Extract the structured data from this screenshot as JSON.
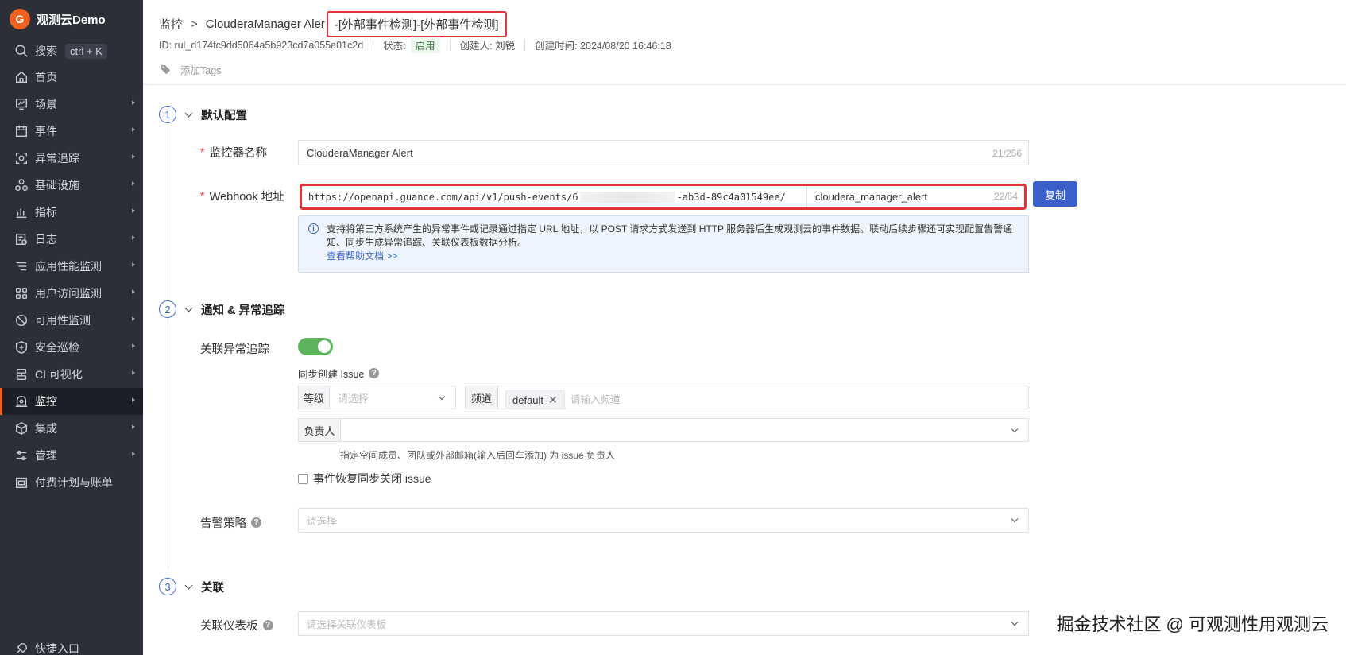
{
  "brand": {
    "logo_letter": "G",
    "name": "观测云Demo"
  },
  "sidebar": {
    "search_label": "搜索",
    "search_shortcut": "ctrl + K",
    "items": [
      {
        "label": "首页",
        "icon": "home-icon",
        "has_children": false
      },
      {
        "label": "场景",
        "icon": "scene-icon",
        "has_children": true
      },
      {
        "label": "事件",
        "icon": "event-icon",
        "has_children": true
      },
      {
        "label": "异常追踪",
        "icon": "anomaly-icon",
        "has_children": true
      },
      {
        "label": "基础设施",
        "icon": "infra-icon",
        "has_children": true
      },
      {
        "label": "指标",
        "icon": "metrics-icon",
        "has_children": true
      },
      {
        "label": "日志",
        "icon": "log-icon",
        "has_children": true
      },
      {
        "label": "应用性能监测",
        "icon": "apm-icon",
        "has_children": true
      },
      {
        "label": "用户访问监测",
        "icon": "rum-icon",
        "has_children": true
      },
      {
        "label": "可用性监测",
        "icon": "availability-icon",
        "has_children": true
      },
      {
        "label": "安全巡检",
        "icon": "security-icon",
        "has_children": true
      },
      {
        "label": "CI 可视化",
        "icon": "ci-icon",
        "has_children": true
      },
      {
        "label": "监控",
        "icon": "monitor-icon",
        "has_children": true,
        "active": true
      },
      {
        "label": "集成",
        "icon": "integration-icon",
        "has_children": true
      },
      {
        "label": "管理",
        "icon": "manage-icon",
        "has_children": true
      },
      {
        "label": "付费计划与账单",
        "icon": "billing-icon",
        "has_children": false
      }
    ],
    "quick_entry": "快捷入口"
  },
  "header": {
    "breadcrumb_root": "监控",
    "breadcrumb_sep": ">",
    "title_main": "ClouderaManager Aler",
    "title_highlight": "-[外部事件检测]-[外部事件检测]",
    "meta": {
      "id": "ID: rul_d174fc9dd5064a5b923cd7a055a01c2d",
      "status_label": "状态:",
      "status_value": "启用",
      "creator": "创建人: 刘锐",
      "created_at": "创建时间: 2024/08/20 16:46:18"
    },
    "add_tags": "添加Tags"
  },
  "section1": {
    "number": "1",
    "title": "默认配置",
    "monitor_name_label": "监控器名称",
    "monitor_name_value": "ClouderaManager Alert",
    "monitor_name_counter": "21/256",
    "webhook_label": "Webhook 地址",
    "webhook_url_prefix": "https://openapi.guance.com/api/v1/push-events/6",
    "webhook_url_suffix": "-ab3d-89c4a01549ee/",
    "webhook_source": "cloudera_manager_alert",
    "webhook_counter": "22/64",
    "copy_button": "复制",
    "info_text": "支持将第三方系统产生的异常事件或记录通过指定 URL 地址，以 POST 请求方式发送到 HTTP 服务器后生成观测云的事件数据。联动后续步骤还可实现配置告警通知、同步生成异常追踪、关联仪表板数据分析。",
    "info_link": "查看帮助文档 >>"
  },
  "section2": {
    "number": "2",
    "title": "通知 & 异常追踪",
    "link_anomaly_label": "关联异常追踪",
    "sync_issue_label": "同步创建 Issue",
    "level_addon": "等级",
    "level_placeholder": "请选择",
    "channel_addon": "频道",
    "channel_tag": "default",
    "channel_placeholder": "请输入频道",
    "owner_addon": "负责人",
    "owner_hint": "指定空间成员、团队或外部邮箱(输入后回车添加) 为 issue 负责人",
    "close_issue_label": "事件恢复同步关闭 issue",
    "alert_policy_label": "告警策略",
    "alert_policy_placeholder": "请选择"
  },
  "section3": {
    "number": "3",
    "title": "关联",
    "dashboard_label": "关联仪表板",
    "dashboard_placeholder": "请选择关联仪表板"
  },
  "watermark": "掘金技术社区 @ 可观测性用观测云"
}
